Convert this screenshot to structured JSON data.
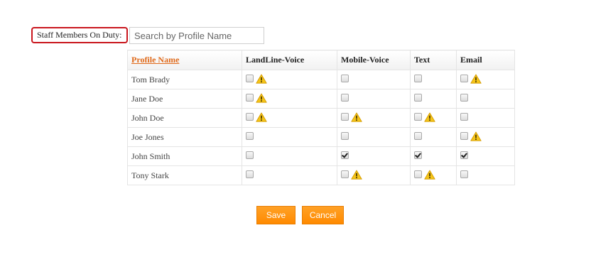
{
  "header": {
    "label": "Staff Members On Duty:",
    "search_placeholder": "Search by Profile Name",
    "search_value": ""
  },
  "table": {
    "columns": [
      "Profile Name",
      "LandLine-Voice",
      "Mobile-Voice",
      "Text",
      "Email"
    ],
    "rows": [
      {
        "name": "Tom Brady",
        "landline": {
          "checked": false,
          "warning": true
        },
        "mobile": {
          "checked": false,
          "warning": false
        },
        "text": {
          "checked": false,
          "warning": false
        },
        "email": {
          "checked": false,
          "warning": true
        }
      },
      {
        "name": "Jane Doe",
        "landline": {
          "checked": false,
          "warning": true
        },
        "mobile": {
          "checked": false,
          "warning": false
        },
        "text": {
          "checked": false,
          "warning": false
        },
        "email": {
          "checked": false,
          "warning": false
        }
      },
      {
        "name": "John Doe",
        "landline": {
          "checked": false,
          "warning": true
        },
        "mobile": {
          "checked": false,
          "warning": true
        },
        "text": {
          "checked": false,
          "warning": true
        },
        "email": {
          "checked": false,
          "warning": false
        }
      },
      {
        "name": "Joe Jones",
        "landline": {
          "checked": false,
          "warning": false
        },
        "mobile": {
          "checked": false,
          "warning": false
        },
        "text": {
          "checked": false,
          "warning": false
        },
        "email": {
          "checked": false,
          "warning": true
        }
      },
      {
        "name": "John Smith",
        "landline": {
          "checked": false,
          "warning": false
        },
        "mobile": {
          "checked": true,
          "warning": false
        },
        "text": {
          "checked": true,
          "warning": false
        },
        "email": {
          "checked": true,
          "warning": false
        }
      },
      {
        "name": "Tony Stark",
        "landline": {
          "checked": false,
          "warning": false
        },
        "mobile": {
          "checked": false,
          "warning": true
        },
        "text": {
          "checked": false,
          "warning": true
        },
        "email": {
          "checked": false,
          "warning": false
        }
      }
    ]
  },
  "buttons": {
    "save_label": "Save",
    "cancel_label": "Cancel"
  },
  "icons": {
    "warning": "warning-icon"
  },
  "colors": {
    "accent_orange": "#ff8a00",
    "link_orange": "#e06a1b",
    "label_border_red": "#c9161d",
    "warning_yellow": "#f5c518"
  }
}
